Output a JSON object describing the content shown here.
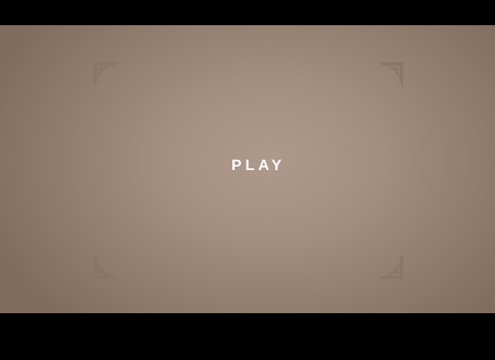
{
  "game": {
    "play_label": "PLAY"
  },
  "colors": {
    "letterbox": "#000000",
    "stage_center": "#ae998a",
    "stage_edge": "#816d5e",
    "ornament": "#8a7565",
    "play_text": "#ffffff"
  },
  "ornaments": {
    "top_left": "corner-ornament-icon",
    "top_right": "corner-ornament-icon",
    "bottom_left": "corner-ornament-icon",
    "bottom_right": "corner-ornament-icon"
  }
}
